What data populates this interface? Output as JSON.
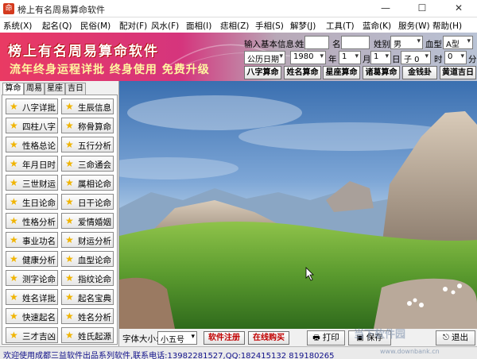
{
  "window": {
    "title": "榜上有名周易算命软件",
    "min": "—",
    "max": "☐",
    "close": "✕"
  },
  "menu": [
    "系统(X)",
    "起名(Q)",
    "民俗(M)",
    "配对(F)",
    "风水(F)",
    "面相(I)",
    "痣相(Z)",
    "手相(S)",
    "解梦(J)",
    "工具(T)",
    "蓝命(K)",
    "服务(W)",
    "帮助(H)"
  ],
  "banner": {
    "brand": "榜上有名周易算命软件",
    "tagline": "流年终身运程详批  终身使用  免费升级"
  },
  "form": {
    "heading": "输入基本信息:",
    "surname_label": "姓",
    "surname_value": "",
    "given_label": "名",
    "given_value": "",
    "gender_label": "姓别",
    "gender_value": "男",
    "blood_label": "血型",
    "blood_value": "A型",
    "calendar_type": "公历日期",
    "year_value": "1980",
    "year_unit": "年",
    "month_value": "1",
    "month_unit": "月",
    "day_value": "1",
    "day_unit": "日",
    "hour_value": "子 0",
    "hour_unit": "时",
    "minute_value": "0",
    "minute_unit": "分"
  },
  "quick_buttons": [
    "八字算命",
    "姓名算命",
    "星座算命",
    "诸葛算命",
    "金钱卦",
    "黄道吉日"
  ],
  "tabs": [
    "算命",
    "周易",
    "星座",
    "吉日"
  ],
  "functions": [
    [
      "八字详批",
      "生辰信息"
    ],
    [
      "四柱八字",
      "称骨算命"
    ],
    [
      "性格总论",
      "五行分析"
    ],
    [
      "年月日时",
      "三命通会"
    ],
    [
      "三世财运",
      "属相论命"
    ],
    [
      "生日论命",
      "日干论命"
    ],
    [
      "性格分析",
      "爱情婚姻"
    ],
    [
      "事业功名",
      "财运分析"
    ],
    [
      "健康分析",
      "血型论命"
    ],
    [
      "测字论命",
      "指纹论命"
    ],
    [
      "姓名详批",
      "起名宝典"
    ],
    [
      "快速起名",
      "姓名分析"
    ],
    [
      "三才吉凶",
      "姓氏起源"
    ]
  ],
  "bottom": {
    "font_label": "字体大小:",
    "font_value": "小五号",
    "register_label": "软件注册",
    "buy_label": "在线购买",
    "print_label": "打印",
    "save_label": "保存",
    "exit_label": "退出"
  },
  "status": {
    "text": "欢迎使用成都三益软件出品系列软件,联系电话:13982281527,QQ:182415132 819180265"
  },
  "watermark": {
    "main": "当下软件园",
    "sub": "www.downbank.cn"
  },
  "colors": {
    "banner_pink": "#e93a63",
    "status_blue": "#10108a",
    "register_red": "#c00000",
    "star_gold": "#f0b400"
  }
}
